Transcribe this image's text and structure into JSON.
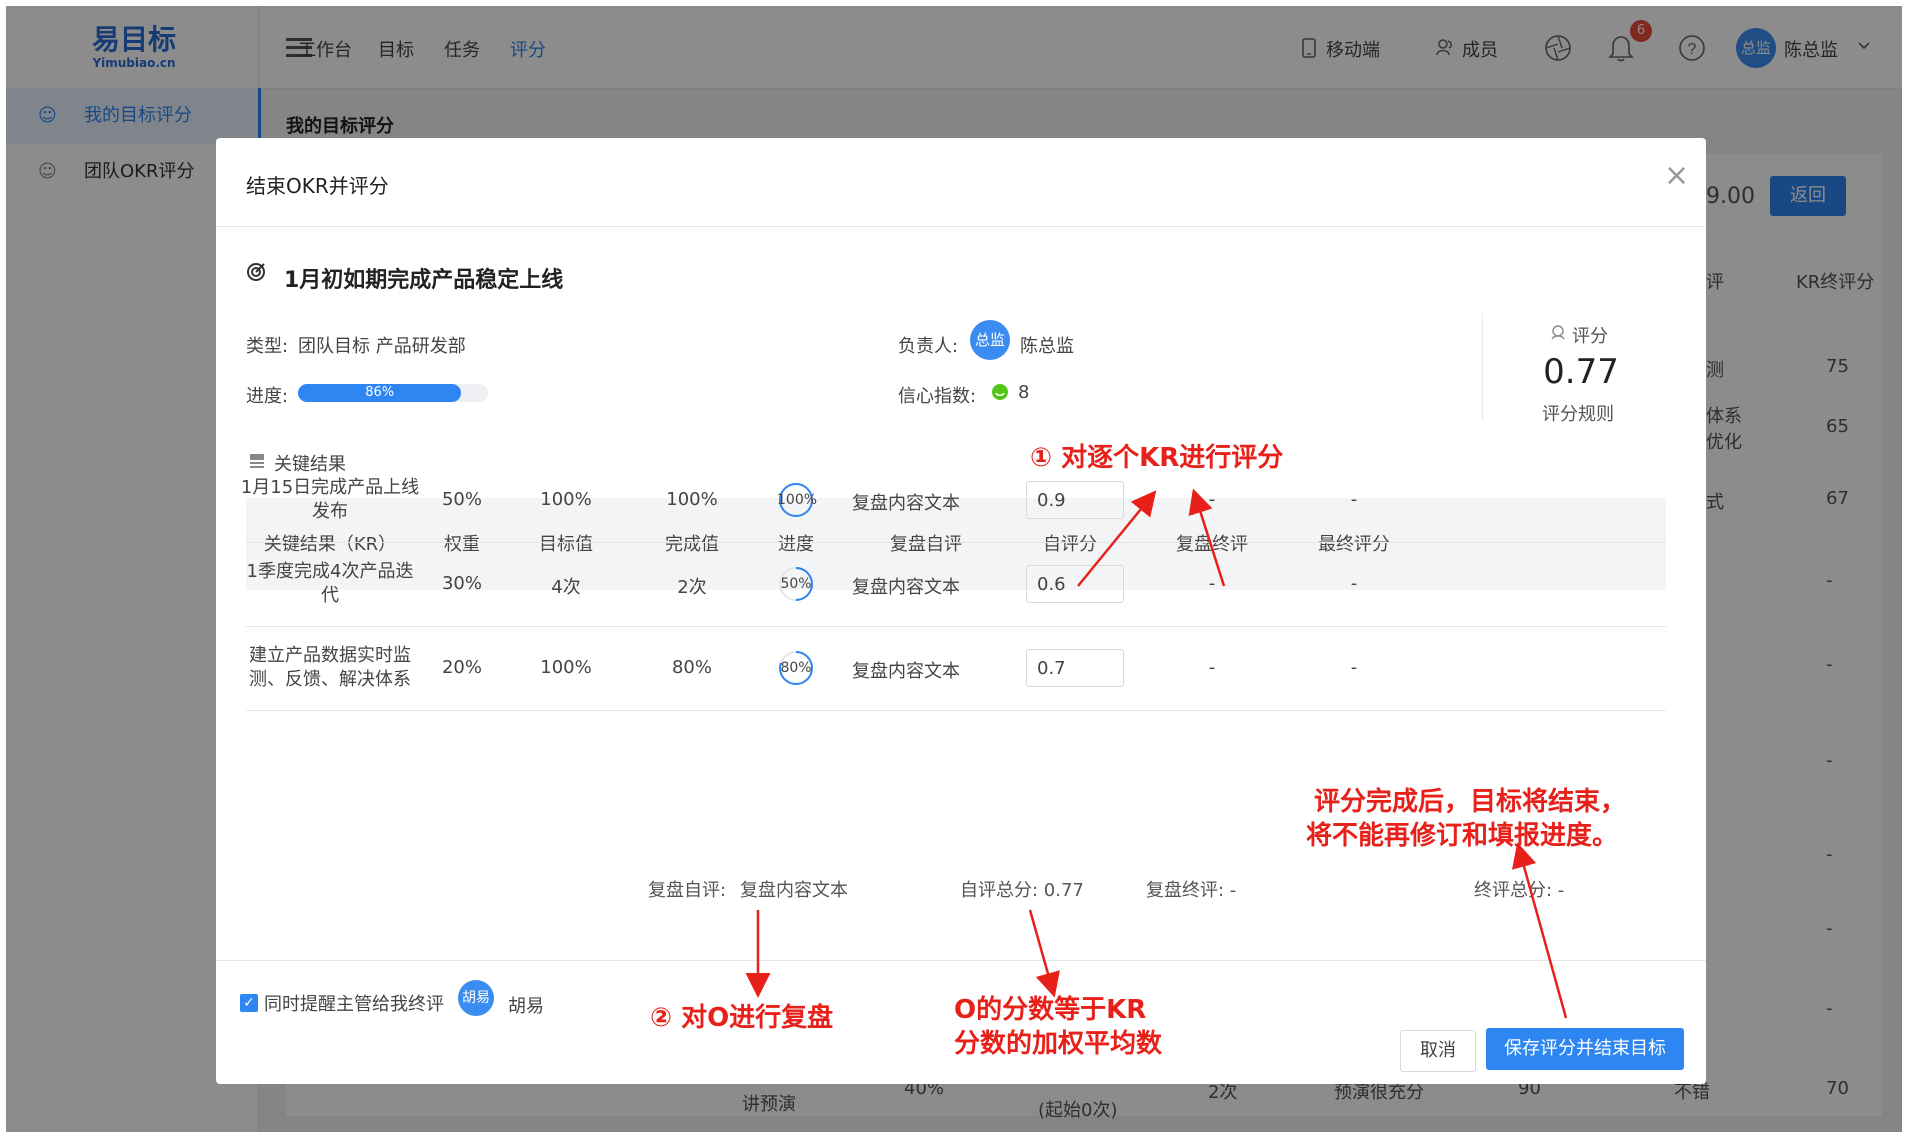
{
  "logo": {
    "cn": "易目标",
    "en": "Yimubiao.cn"
  },
  "nav": [
    "工作台",
    "目标",
    "任务",
    "评分"
  ],
  "topright": {
    "mobile": "移动端",
    "members": "成员",
    "badge": "6",
    "avatar": "总监",
    "user": "陈总监"
  },
  "sidebar": [
    "我的目标评分",
    "团队OKR评分"
  ],
  "main_title": "我的目标评分",
  "background": {
    "score_partial": "9.00",
    "back": "返回",
    "col_partial": "评",
    "col_kr_final": "KR终评分",
    "rows": [
      {
        "text": "测",
        "value": "75"
      },
      {
        "text": "体系\n优化",
        "value": "65"
      },
      {
        "text": "式",
        "value": "67"
      },
      {
        "text": "",
        "value": "-"
      },
      {
        "text": "",
        "value": "-"
      },
      {
        "text": "",
        "value": "-"
      },
      {
        "text": "",
        "value": "-"
      },
      {
        "text": "",
        "value": "-"
      },
      {
        "text": "",
        "value": "-"
      }
    ],
    "bottom_row": [
      "讲预演",
      "40%",
      "(起始0次)",
      "2次",
      "预演很充分",
      "90",
      "不错",
      "70"
    ]
  },
  "modal": {
    "title": "结束OKR并评分",
    "objective": "1月初如期完成产品稳定上线",
    "type_label": "类型:",
    "type_value": "团队目标 产品研发部",
    "owner_label": "负责人:",
    "owner_avatar": "总监",
    "owner_name": "陈总监",
    "progress_label": "进度:",
    "progress_value": 86,
    "progress_text": "86%",
    "confidence_label": "信心指数:",
    "confidence_value": "8",
    "score_label": "评分",
    "score_value": "0.77",
    "score_rules": "评分规则",
    "kr_section": "关键结果",
    "columns": [
      "关键结果（KR）",
      "权重",
      "目标值",
      "完成值",
      "进度",
      "复盘自评",
      "自评分",
      "复盘终评",
      "最终评分"
    ],
    "rows": [
      {
        "kr": "1月15日完成产品上线发布",
        "weight": "50%",
        "target": "100%",
        "done": "100%",
        "progress": 100,
        "progress_text": "100%",
        "review": "复盘内容文本",
        "self_score": "0.9",
        "final_review": "-",
        "final_score": "-"
      },
      {
        "kr": "1季度完成4次产品迭代",
        "weight": "30%",
        "target": "4次",
        "done": "2次",
        "progress": 50,
        "progress_text": "50%",
        "review": "复盘内容文本",
        "self_score": "0.6",
        "final_review": "-",
        "final_score": "-"
      },
      {
        "kr": "建立产品数据实时监测、反馈、解决体系",
        "weight": "20%",
        "target": "100%",
        "done": "80%",
        "progress": 80,
        "progress_text": "80%",
        "review": "复盘内容文本",
        "self_score": "0.7",
        "final_review": "-",
        "final_score": "-"
      }
    ],
    "summary": {
      "review_label": "复盘自评:",
      "review_value": "复盘内容文本",
      "self_total": "自评总分:  0.77",
      "final_review": "复盘终评:  -",
      "final_total": "终评总分:  -"
    },
    "remind": "同时提醒主管给我终评",
    "manager_avatar": "胡易",
    "manager_name": "胡易",
    "cancel": "取消",
    "save": "保存评分并结束目标"
  },
  "annotations": {
    "a1": "①  对逐个KR进行评分",
    "a2": "②  对O进行复盘",
    "a3_line1": "O的分数等于KR",
    "a3_line2": "分数的加权平均数",
    "a4_line1": "评分完成后，目标将结束，",
    "a4_line2": "将不能再修订和填报进度。"
  },
  "colors": {
    "primary": "#2d86f2",
    "annotation": "#e8201a",
    "confidence": "#52c41a"
  }
}
